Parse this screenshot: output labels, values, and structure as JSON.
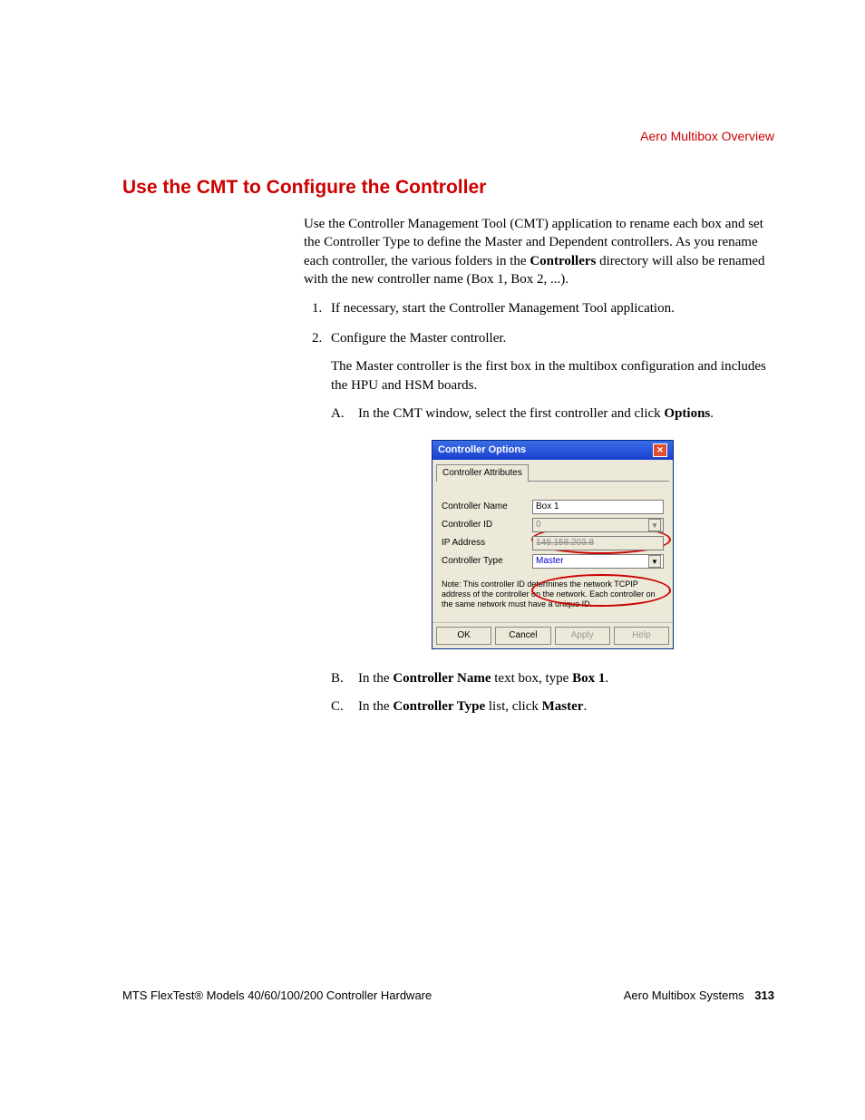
{
  "header": {
    "right": "Aero Multibox Overview"
  },
  "title": "Use the CMT to Configure the Controller",
  "intro": {
    "part1": "Use the Controller Management Tool (CMT) application to rename each box and set the Controller Type to define the Master and Dependent controllers. As you rename each controller, the various folders in the ",
    "bold1": "Controllers",
    "part2": " directory will also be renamed with the new controller name (Box 1, Box 2, ...)."
  },
  "steps": {
    "s1": "If necessary, start the Controller Management Tool application.",
    "s2": "Configure the Master controller.",
    "s2_sub": "The Master controller is the first box in the multibox configuration and includes the HPU and HSM boards.",
    "A": {
      "letter": "A.",
      "pre": "In the CMT window, select the first controller and click ",
      "bold": "Options",
      "post": "."
    },
    "B": {
      "letter": "B.",
      "pre": "In the ",
      "b1": "Controller Name",
      "mid": " text box, type ",
      "b2": "Box 1",
      "post": "."
    },
    "C": {
      "letter": "C.",
      "pre": "In the ",
      "b1": "Controller Type",
      "mid": " list, click ",
      "b2": "Master",
      "post": "."
    }
  },
  "dialog": {
    "title": "Controller Options",
    "tab": "Controller Attributes",
    "labels": {
      "name": "Controller Name",
      "id": "Controller ID",
      "ip": "IP Address",
      "type": "Controller Type"
    },
    "values": {
      "name": "Box 1",
      "id": "0",
      "ip": "148.158.203.8",
      "type": "Master"
    },
    "note": "Note: This controller ID determines the network TCPIP address of the controller on the network. Each controller on the same network must have a unique ID.",
    "buttons": {
      "ok": "OK",
      "cancel": "Cancel",
      "apply": "Apply",
      "help": "Help"
    }
  },
  "footer": {
    "left": "MTS FlexTest® Models 40/60/100/200 Controller Hardware",
    "right": "Aero Multibox Systems",
    "page": "313"
  }
}
